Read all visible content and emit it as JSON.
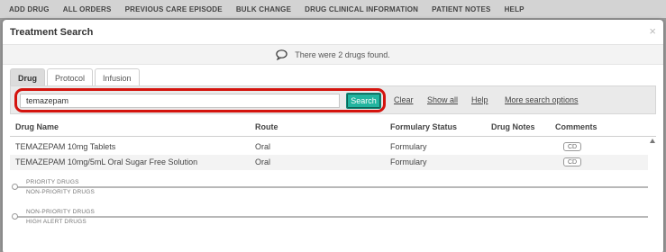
{
  "topnav": {
    "items": [
      "ADD DRUG",
      "ALL ORDERS",
      "PREVIOUS CARE EPISODE",
      "BULK CHANGE",
      "DRUG CLINICAL INFORMATION",
      "PATIENT NOTES",
      "HELP"
    ]
  },
  "modal": {
    "title": "Treatment Search",
    "close": "×"
  },
  "notice": {
    "icon": "speech-bubble-icon",
    "text": "There were 2 drugs found."
  },
  "tabs": [
    {
      "label": "Drug",
      "active": true
    },
    {
      "label": "Protocol",
      "active": false
    },
    {
      "label": "Infusion",
      "active": false
    }
  ],
  "search": {
    "value": "temazepam",
    "button": "Search",
    "links": [
      "Clear",
      "Show all",
      "Help",
      "More search options"
    ]
  },
  "table": {
    "columns": [
      "Drug Name",
      "Route",
      "Formulary Status",
      "Drug Notes",
      "Comments"
    ],
    "rows": [
      {
        "name": "TEMAZEPAM 10mg Tablets",
        "route": "Oral",
        "formulary": "Formulary",
        "notes": "",
        "comment": "CD"
      },
      {
        "name": "TEMAZEPAM 10mg/5mL Oral Sugar Free Solution",
        "route": "Oral",
        "formulary": "Formulary",
        "notes": "",
        "comment": "CD"
      }
    ]
  },
  "dividers": [
    {
      "above": "PRIORITY DRUGS",
      "below": "NON-PRIORITY DRUGS"
    },
    {
      "above": "NON-PRIORITY DRUGS",
      "below": "HIGH ALERT DRUGS"
    }
  ],
  "colors": {
    "highlight": "#d4140e",
    "search_button": "#22b49f"
  }
}
